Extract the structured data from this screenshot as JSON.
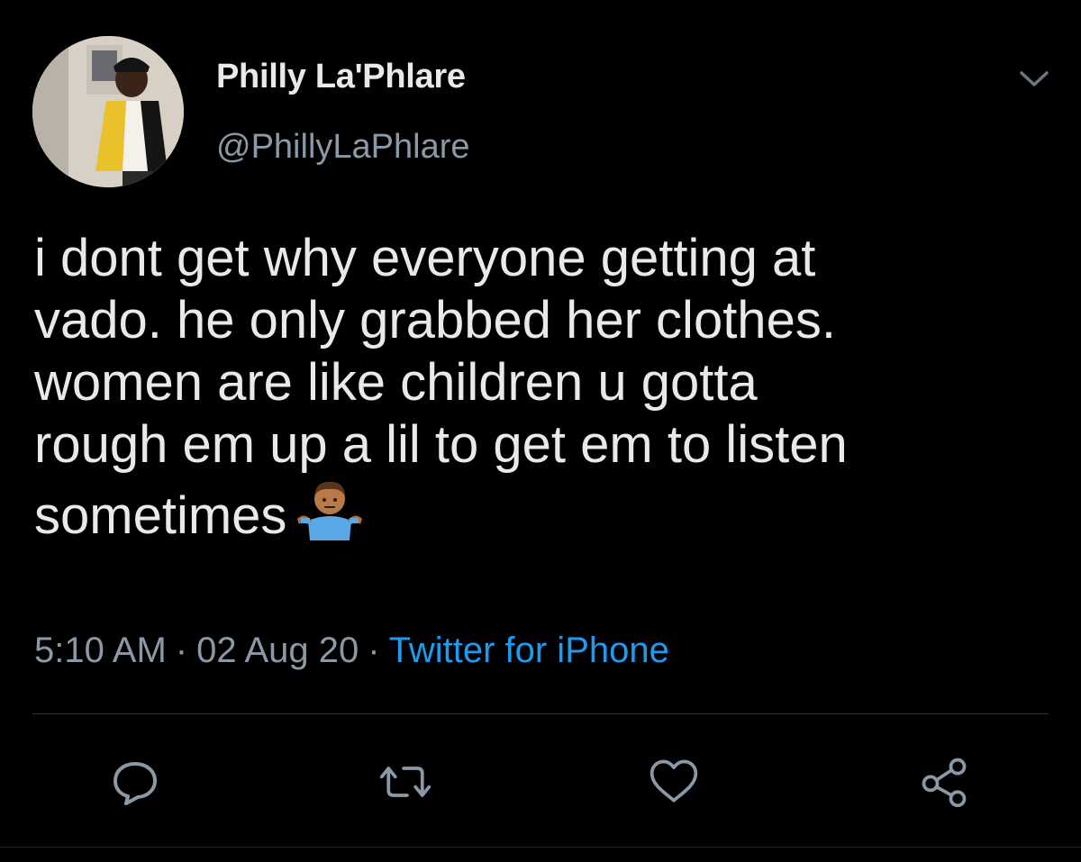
{
  "tweet": {
    "display_name": "Philly La'Phlare",
    "handle": "@PhillyLaPhlare",
    "text_lines": [
      "i dont get why everyone getting at",
      "vado. he only grabbed her clothes.",
      "women are like children u gotta",
      "rough em up a lil to get em to listen",
      "sometimes"
    ],
    "emoji": "person-shrugging-emoji",
    "time": "5:10 AM",
    "date": "02 Aug 20",
    "source": "Twitter for iPhone",
    "separator": "·"
  },
  "icons": {
    "more": "chevron-down-icon",
    "reply": "reply-icon",
    "retweet": "retweet-icon",
    "like": "heart-icon",
    "share": "share-icon"
  },
  "colors": {
    "background": "#000000",
    "text": "#e7e9ea",
    "secondary": "#8b98a5",
    "link": "#1d9bf0",
    "divider": "#2f3336"
  }
}
